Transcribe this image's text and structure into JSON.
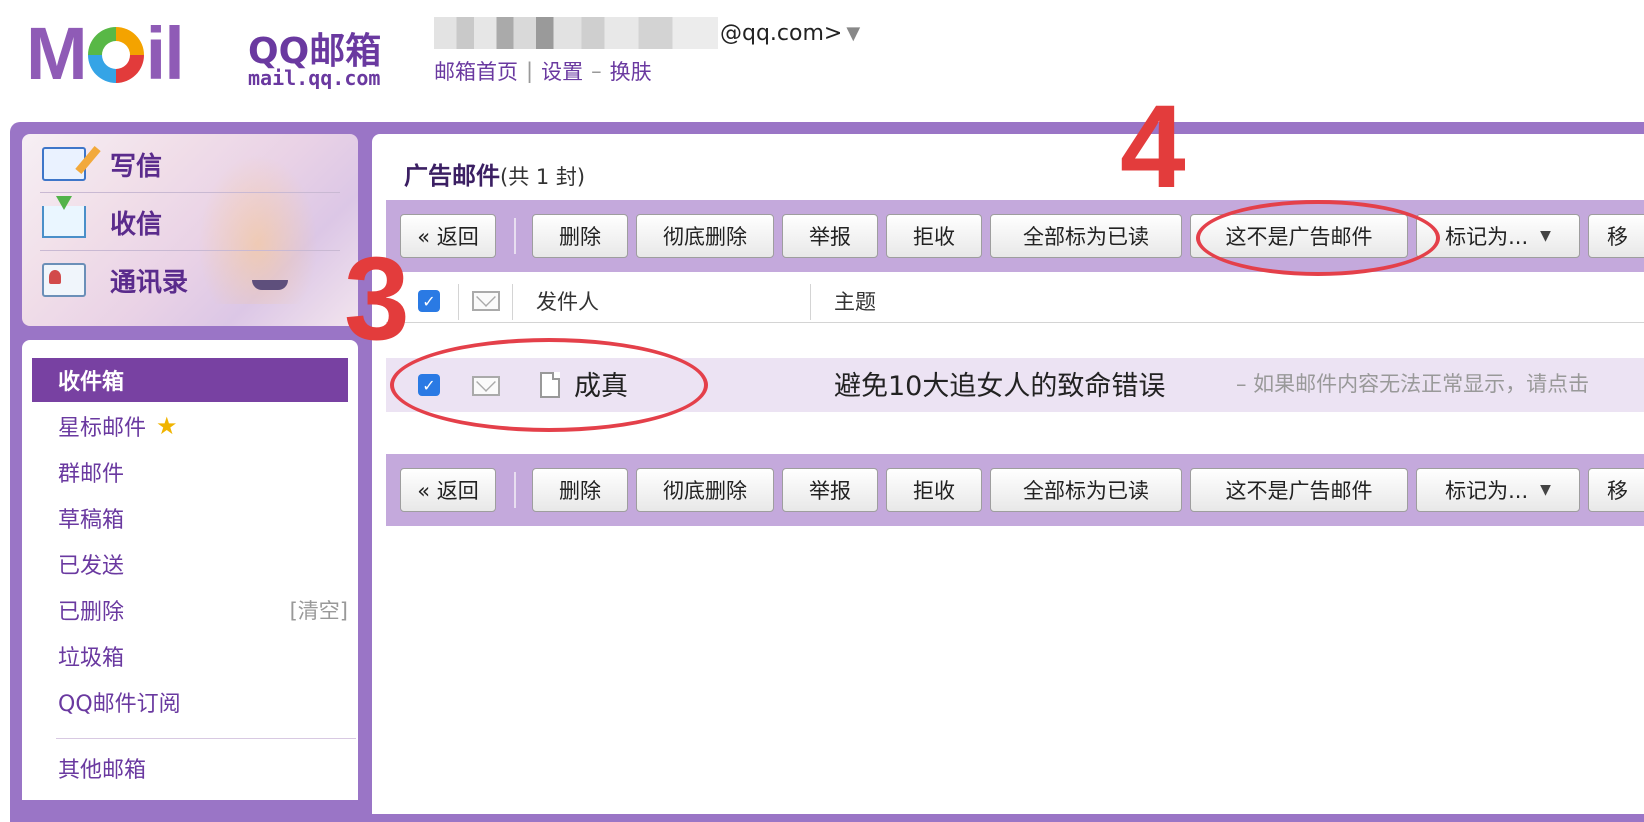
{
  "header": {
    "logo_text": "MOil",
    "brand_name": "QQ邮箱",
    "brand_url": "mail.qq.com",
    "account_domain": "@qq.com>",
    "account_caret": "▼",
    "links": [
      "邮箱首页",
      "设置",
      "换肤"
    ],
    "link_separators": [
      "|",
      "–"
    ]
  },
  "quick_actions": [
    {
      "label": "写信",
      "icon": "compose-icon"
    },
    {
      "label": "收信",
      "icon": "receive-icon"
    },
    {
      "label": "通讯录",
      "icon": "contacts-icon"
    }
  ],
  "folders": [
    {
      "label": "收件箱",
      "active": true
    },
    {
      "label": "星标邮件",
      "icon": "star-icon"
    },
    {
      "label": "群邮件"
    },
    {
      "label": "草稿箱"
    },
    {
      "label": "已发送"
    },
    {
      "label": "已删除",
      "action": "[清空]"
    },
    {
      "label": "垃圾箱"
    },
    {
      "label": "QQ邮件订阅"
    },
    {
      "label": "其他邮箱"
    }
  ],
  "main": {
    "folder_title": "广告邮件",
    "count_text": "(共 1 封)",
    "toolbar": {
      "back": "« 返回",
      "delete": "删除",
      "delete_permanently": "彻底删除",
      "report": "举报",
      "reject": "拒收",
      "mark_all_read": "全部标为已读",
      "not_spam": "这不是广告邮件",
      "mark_as": "标记为...",
      "mark_as_caret": "▼",
      "move_to": "移"
    },
    "columns": {
      "sender": "发件人",
      "subject": "主题"
    },
    "messages": [
      {
        "checked": true,
        "sender": "成真",
        "subject": "避免10大追女人的致命错误",
        "snippet": "– 如果邮件内容无法正常显示，请点击"
      }
    ]
  },
  "annotations": {
    "step3": "3",
    "step4": "4"
  },
  "colors": {
    "brand_purple": "#7841a2",
    "toolbar_bg": "#c4a9dc",
    "frame_purple": "#9a75c6",
    "annotation_red": "#e33c3c",
    "checkbox_blue": "#2a7ae4"
  }
}
